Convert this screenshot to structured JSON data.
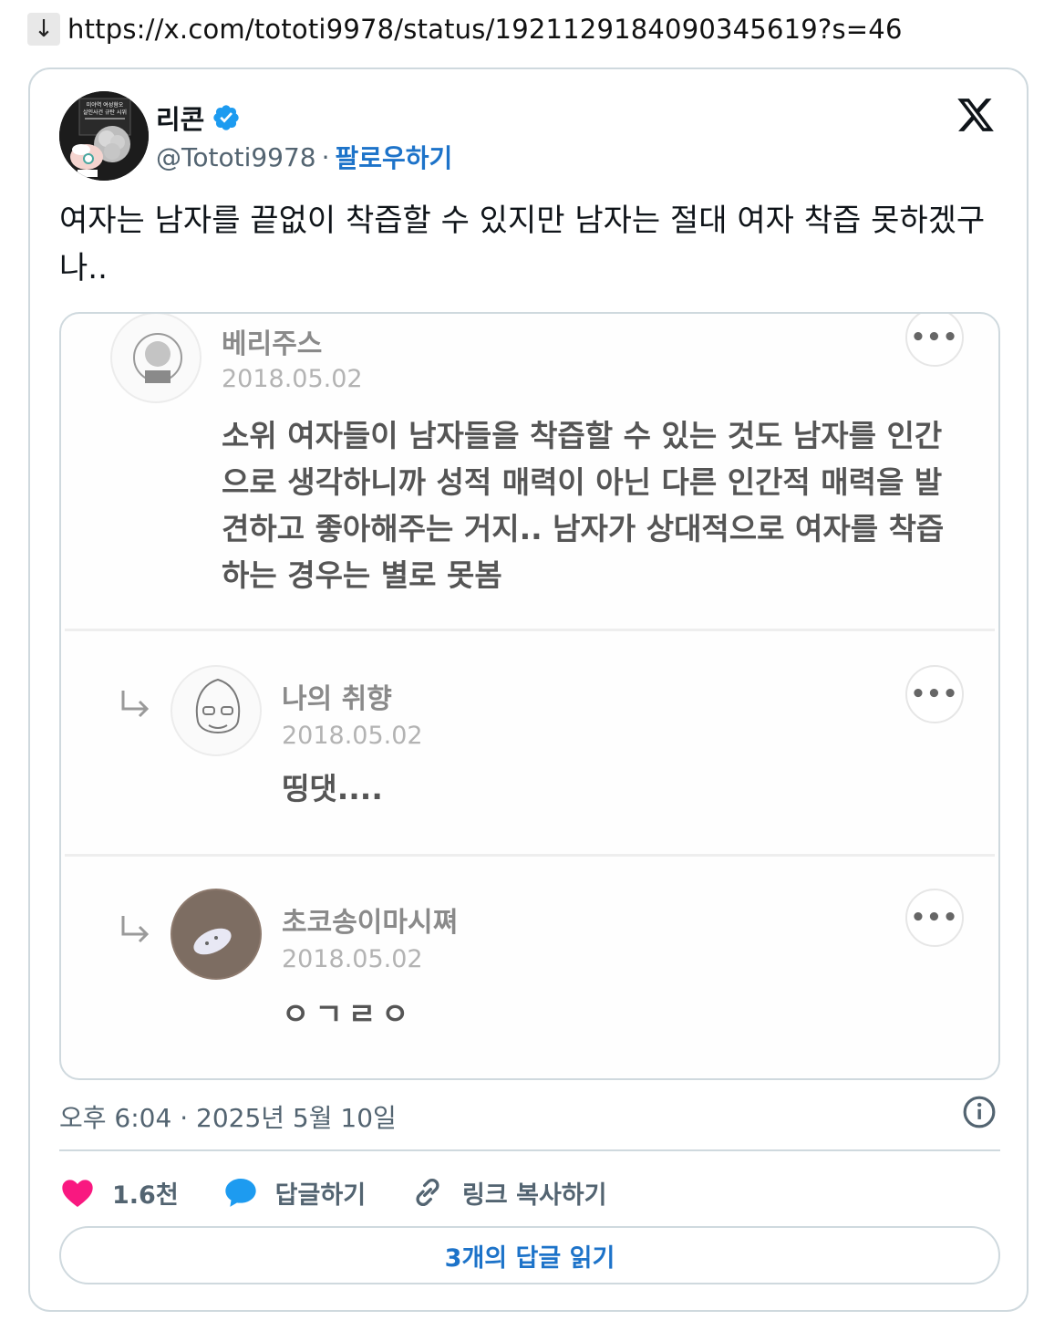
{
  "url_bar": {
    "arrow": "↓",
    "url": "https://x.com/tototi9978/status/1921129184090345619?s=46"
  },
  "author": {
    "name": "리콘",
    "handle": "@Tototi9978",
    "separator": "·",
    "follow_label": "팔로우하기",
    "verified_icon": "verified-badge-icon",
    "brand_icon": "x-logo-icon",
    "avatar_caption": [
      "미야역 여성혐오",
      "살인사건 규탄 시위"
    ]
  },
  "tweet": {
    "text": "여자는 남자를 끝없이 착즙할 수 있지만 남자는 절대 여자 착즙 못하겠구나.."
  },
  "media": {
    "comments": [
      {
        "name": "베리주스",
        "date": "2018.05.02",
        "body": "소위 여자들이 남자들을 착즙할 수 있는 것도 남자를 인간으로 생각하니까 성적 매력이 아닌 다른 인간적 매력을 발견하고 좋아해주는 거지.. 남자가 상대적으로 여자를 착즙하는 경우는 별로 못봄",
        "more": "•••",
        "reply": false
      },
      {
        "name": "나의 취향",
        "date": "2018.05.02",
        "body": "띵댓....",
        "more": "•••",
        "reply": true
      },
      {
        "name": "초코송이마시쪄",
        "date": "2018.05.02",
        "body": "ㅇㄱㄹㅇ",
        "more": "•••",
        "reply": true
      }
    ]
  },
  "meta": {
    "timestamp": "오후 6:04 · 2025년 5월 10일",
    "info_icon": "info-icon"
  },
  "actions": {
    "like_count": "1.6천",
    "reply_label": "답글하기",
    "copy_link_label": "링크 복사하기",
    "like_color": "#f91880",
    "reply_color": "#1d9bf0"
  },
  "read_replies_label": "3개의 답글 읽기",
  "colors": {
    "accent": "#1d73c9",
    "secondary_text": "#536471",
    "border": "#cfd9de"
  }
}
